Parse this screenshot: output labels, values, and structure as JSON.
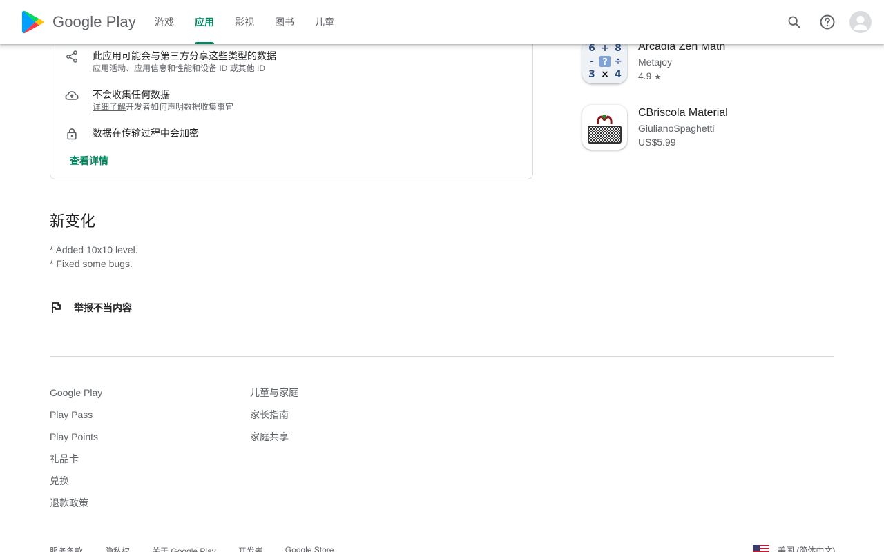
{
  "header": {
    "brand": "Google Play",
    "nav": [
      {
        "label": "游戏",
        "active": false
      },
      {
        "label": "应用",
        "active": true
      },
      {
        "label": "影视",
        "active": false
      },
      {
        "label": "图书",
        "active": false
      },
      {
        "label": "儿童",
        "active": false
      }
    ],
    "icons": [
      "search-icon",
      "help-icon",
      "account-avatar"
    ],
    "accent_color": "#01875f"
  },
  "data_safety": {
    "rows": [
      {
        "icon": "share-icon",
        "title": "此应用可能会与第三方分享这些类型的数据",
        "subtitle": "应用活动、应用信息和性能和设备 ID 或其他 ID"
      },
      {
        "icon": "cloud-upload-icon",
        "title": "不会收集任何数据",
        "subtitle_link": "详细了解",
        "subtitle": "开发者如何声明数据收集事宜"
      },
      {
        "icon": "lock-icon",
        "title": "数据在传输过程中会加密"
      }
    ],
    "see_details": "查看详情"
  },
  "whats_new": {
    "title": "新变化",
    "lines": [
      "* Added 10x10 level.",
      "* Fixed some bugs."
    ]
  },
  "report": {
    "label": "举报不当内容",
    "icon": "flag-icon"
  },
  "similar_apps": [
    {
      "name": "Arcadia Zen Math",
      "developer": "Metajoy",
      "rating": "4.9",
      "rating_icon": "star-icon"
    },
    {
      "name": "CBriscola Material",
      "developer": "GiulianoSpaghetti",
      "price": "US$5.99"
    }
  ],
  "footer": {
    "col1": {
      "title": "Google Play",
      "links": [
        "Play Pass",
        "Play Points",
        "礼品卡",
        "兑换",
        "退款政策"
      ]
    },
    "col2": {
      "title": "儿童与家庭",
      "links": [
        "家长指南",
        "家庭共享"
      ]
    },
    "bottom_links": [
      "服务条款",
      "隐私权",
      "关于 Google Play",
      "开发者",
      "Google Store"
    ],
    "region": "美国 (简体中文)"
  }
}
